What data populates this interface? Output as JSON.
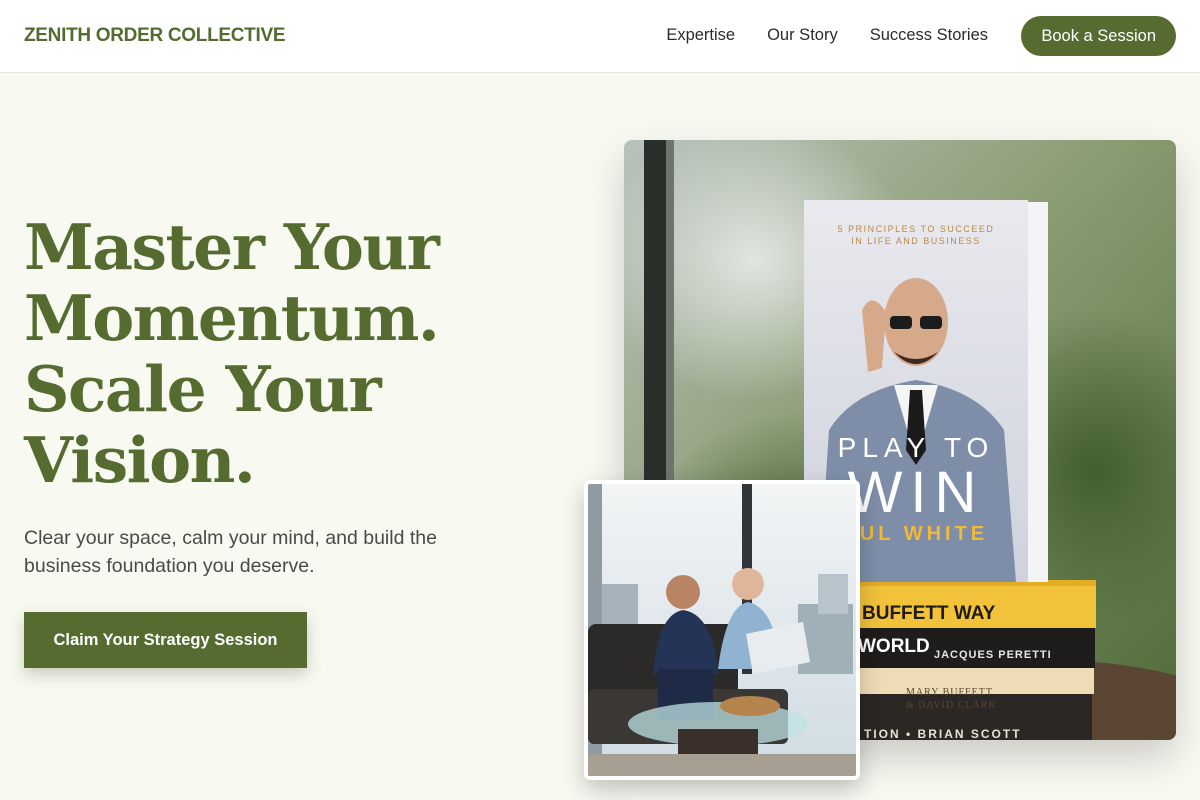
{
  "header": {
    "brand": "ZENITH ORDER COLLECTIVE",
    "nav": [
      "Expertise",
      "Our Story",
      "Success Stories"
    ],
    "cta": "Book a Session"
  },
  "hero": {
    "headline_lines": [
      "Master Your",
      "Momentum.",
      "Scale Your",
      "Vision."
    ],
    "subhead": "Clear your space, calm your mind, and build the business foundation you deserve.",
    "cta": "Claim Your Strategy Session"
  },
  "images": {
    "main": {
      "book_tagline_1": "5 PRINCIPLES TO SUCCEED",
      "book_tagline_2": "IN LIFE AND BUSINESS",
      "book_title_1": "PLAY TO",
      "book_title_2": "WIN",
      "book_author": "UL WHITE",
      "stack_1": "BUFFETT WAY",
      "stack_2": "WORLD",
      "stack_2_author": "JACQUES PERETTI",
      "stack_3_author_1": "MARY BUFFETT",
      "stack_3_author_2": "& DAVID CLARK",
      "stack_4": "TION • BRIAN SCOTT"
    }
  },
  "colors": {
    "brand": "#556b2f",
    "background": "#f8f9f1",
    "header_bg": "#ffffff"
  }
}
